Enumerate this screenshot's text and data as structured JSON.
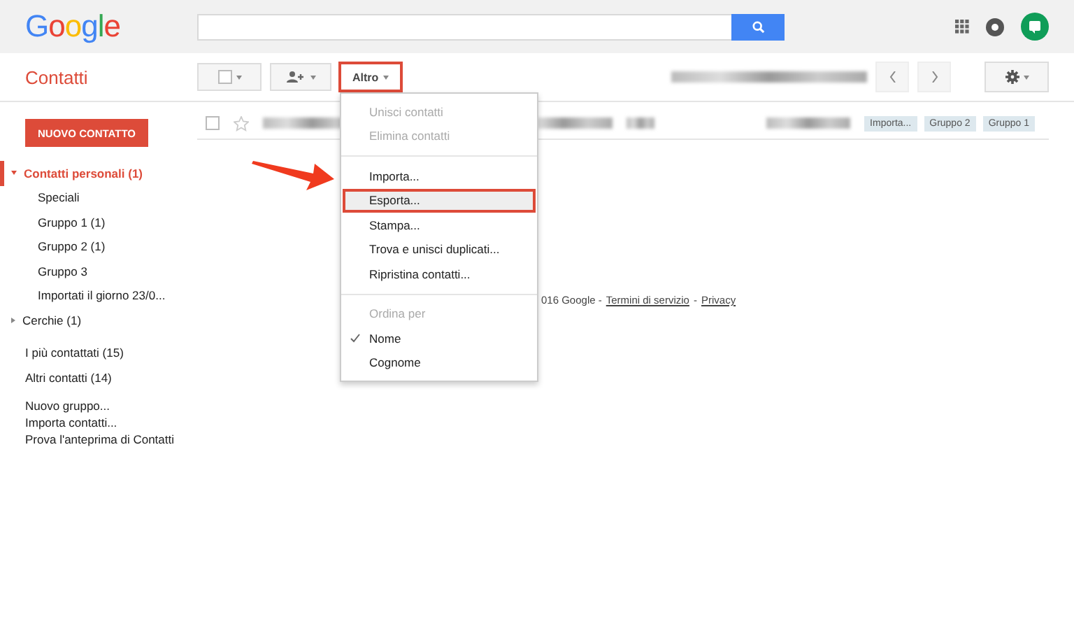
{
  "header": {
    "logo": "Google"
  },
  "app_title": "Contatti",
  "toolbar": {
    "more_button": {
      "label": "Altro",
      "highlighted": true
    }
  },
  "new_contact_button": "NUOVO CONTATTO",
  "sidebar": {
    "groups": [
      {
        "label": "Contatti personali (1)",
        "expanded": true,
        "selected": true,
        "children": [
          {
            "label": "Speciali"
          },
          {
            "label": "Gruppo 1 (1)"
          },
          {
            "label": "Gruppo 2 (1)"
          },
          {
            "label": "Gruppo 3"
          },
          {
            "label": "Importati il giorno 23/0..."
          }
        ]
      },
      {
        "label": "Cerchie (1)",
        "expanded": false,
        "selected": false
      }
    ],
    "items": [
      "I più contattati (15)",
      "Altri contatti (14)"
    ],
    "links": [
      "Nuovo gruppo...",
      "Importa contatti...",
      "Prova l'anteprima di Contatti"
    ]
  },
  "contact_row": {
    "checked": false,
    "starred": false,
    "tags": [
      "Importa...",
      "Gruppo 2",
      "Gruppo 1"
    ]
  },
  "footer": {
    "text": "016 Google -",
    "links": [
      "Termini di servizio",
      "Privacy"
    ],
    "separator": "-"
  },
  "menu": {
    "items": [
      {
        "kind": "action",
        "label": "Unisci contatti",
        "disabled": true,
        "highlighted": false
      },
      {
        "kind": "action",
        "label": "Elimina contatti",
        "disabled": true,
        "highlighted": false
      },
      {
        "kind": "divider"
      },
      {
        "kind": "action",
        "label": "Importa...",
        "disabled": false,
        "highlighted": false
      },
      {
        "kind": "action",
        "label": "Esporta...",
        "disabled": false,
        "highlighted": true
      },
      {
        "kind": "action",
        "label": "Stampa...",
        "disabled": false,
        "highlighted": false
      },
      {
        "kind": "action",
        "label": "Trova e unisci duplicati...",
        "disabled": false,
        "highlighted": false
      },
      {
        "kind": "action",
        "label": "Ripristina contatti...",
        "disabled": false,
        "highlighted": false
      },
      {
        "kind": "divider"
      },
      {
        "kind": "heading",
        "label": "Ordina per"
      },
      {
        "kind": "option",
        "label": "Nome",
        "checked": true
      },
      {
        "kind": "option",
        "label": "Cognome",
        "checked": false
      }
    ]
  }
}
